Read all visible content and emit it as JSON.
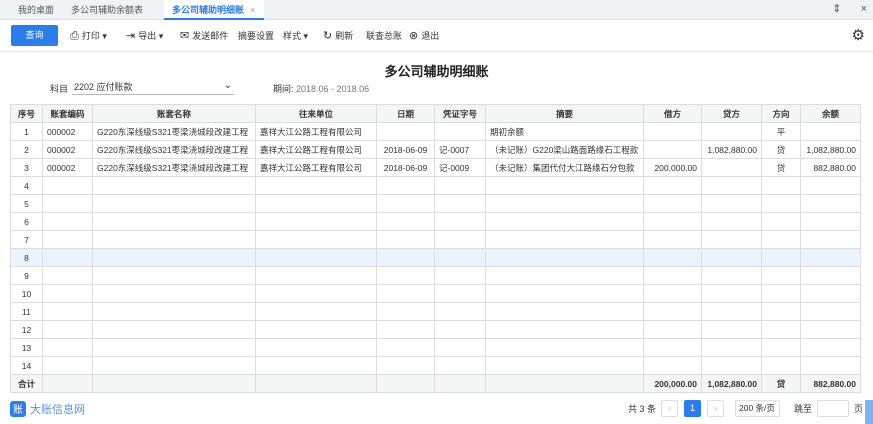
{
  "tabs": [
    {
      "label": "我的桌面"
    },
    {
      "label": "多公司辅助余额表"
    },
    {
      "label": "多公司辅助明细账",
      "close": "×"
    }
  ],
  "window": {
    "restore": "⇕",
    "close": "×"
  },
  "toolbar": {
    "query": "查询",
    "print": "打印",
    "export": "导出",
    "send_email": "发送邮件",
    "summary_settings": "摘要设置",
    "style": "样式",
    "refresh": "刷新",
    "linked_ledger": "联查总账",
    "exit": "退出"
  },
  "report": {
    "title": "多公司辅助明细账",
    "subject_label": "科目",
    "subject_value": "2202 应付账款",
    "period_label": "期间:",
    "period_value": "2018.06 - 2018.06"
  },
  "table": {
    "headers": [
      "序号",
      "账套编码",
      "账套名称",
      "往来单位",
      "日期",
      "凭证字号",
      "摘要",
      "借方",
      "贷方",
      "方向",
      "余额"
    ],
    "rows": [
      [
        "1",
        "000002",
        "G220东深线级S321枣梁浇城段改建工程",
        "嘉祥大江公路工程有限公司",
        "",
        "",
        "期初余额",
        "",
        "",
        "平",
        ""
      ],
      [
        "2",
        "000002",
        "G220东深线级S321枣梁浇城段改建工程",
        "嘉祥大江公路工程有限公司",
        "2018-06-09",
        "记-0007",
        "（未记账）G220梁山路面路缘石工程款",
        "",
        "1,082,880.00",
        "贷",
        "1,082,880.00"
      ],
      [
        "3",
        "000002",
        "G220东深线级S321枣梁浇城段改建工程",
        "嘉祥大江公路工程有限公司",
        "2018-06-09",
        "记-0009",
        "（未记账）集团代付大江路缘石分包款",
        "200,000.00",
        "",
        "贷",
        "882,880.00"
      ],
      [
        "4",
        "",
        "",
        "",
        "",
        "",
        "",
        "",
        "",
        "",
        ""
      ],
      [
        "5",
        "",
        "",
        "",
        "",
        "",
        "",
        "",
        "",
        "",
        ""
      ],
      [
        "6",
        "",
        "",
        "",
        "",
        "",
        "",
        "",
        "",
        "",
        ""
      ],
      [
        "7",
        "",
        "",
        "",
        "",
        "",
        "",
        "",
        "",
        "",
        ""
      ],
      [
        "8",
        "",
        "",
        "",
        "",
        "",
        "",
        "",
        "",
        "",
        ""
      ],
      [
        "9",
        "",
        "",
        "",
        "",
        "",
        "",
        "",
        "",
        "",
        ""
      ],
      [
        "10",
        "",
        "",
        "",
        "",
        "",
        "",
        "",
        "",
        "",
        ""
      ],
      [
        "11",
        "",
        "",
        "",
        "",
        "",
        "",
        "",
        "",
        "",
        ""
      ],
      [
        "12",
        "",
        "",
        "",
        "",
        "",
        "",
        "",
        "",
        "",
        ""
      ],
      [
        "13",
        "",
        "",
        "",
        "",
        "",
        "",
        "",
        "",
        "",
        ""
      ],
      [
        "14",
        "",
        "",
        "",
        "",
        "",
        "",
        "",
        "",
        "",
        ""
      ]
    ],
    "total": {
      "label": "合计",
      "debit": "200,000.00",
      "credit": "1,082,880.00",
      "direction": "贷",
      "balance": "882,880.00"
    }
  },
  "pager": {
    "total_text": "共 3 条",
    "prev": "‹",
    "current_page": "1",
    "next": "›",
    "page_size": "200 条/页",
    "jump_label": "跳至",
    "page_suffix": "页"
  },
  "brand": {
    "logo_text": "大账信息网",
    "accent": "#2b7de9"
  }
}
